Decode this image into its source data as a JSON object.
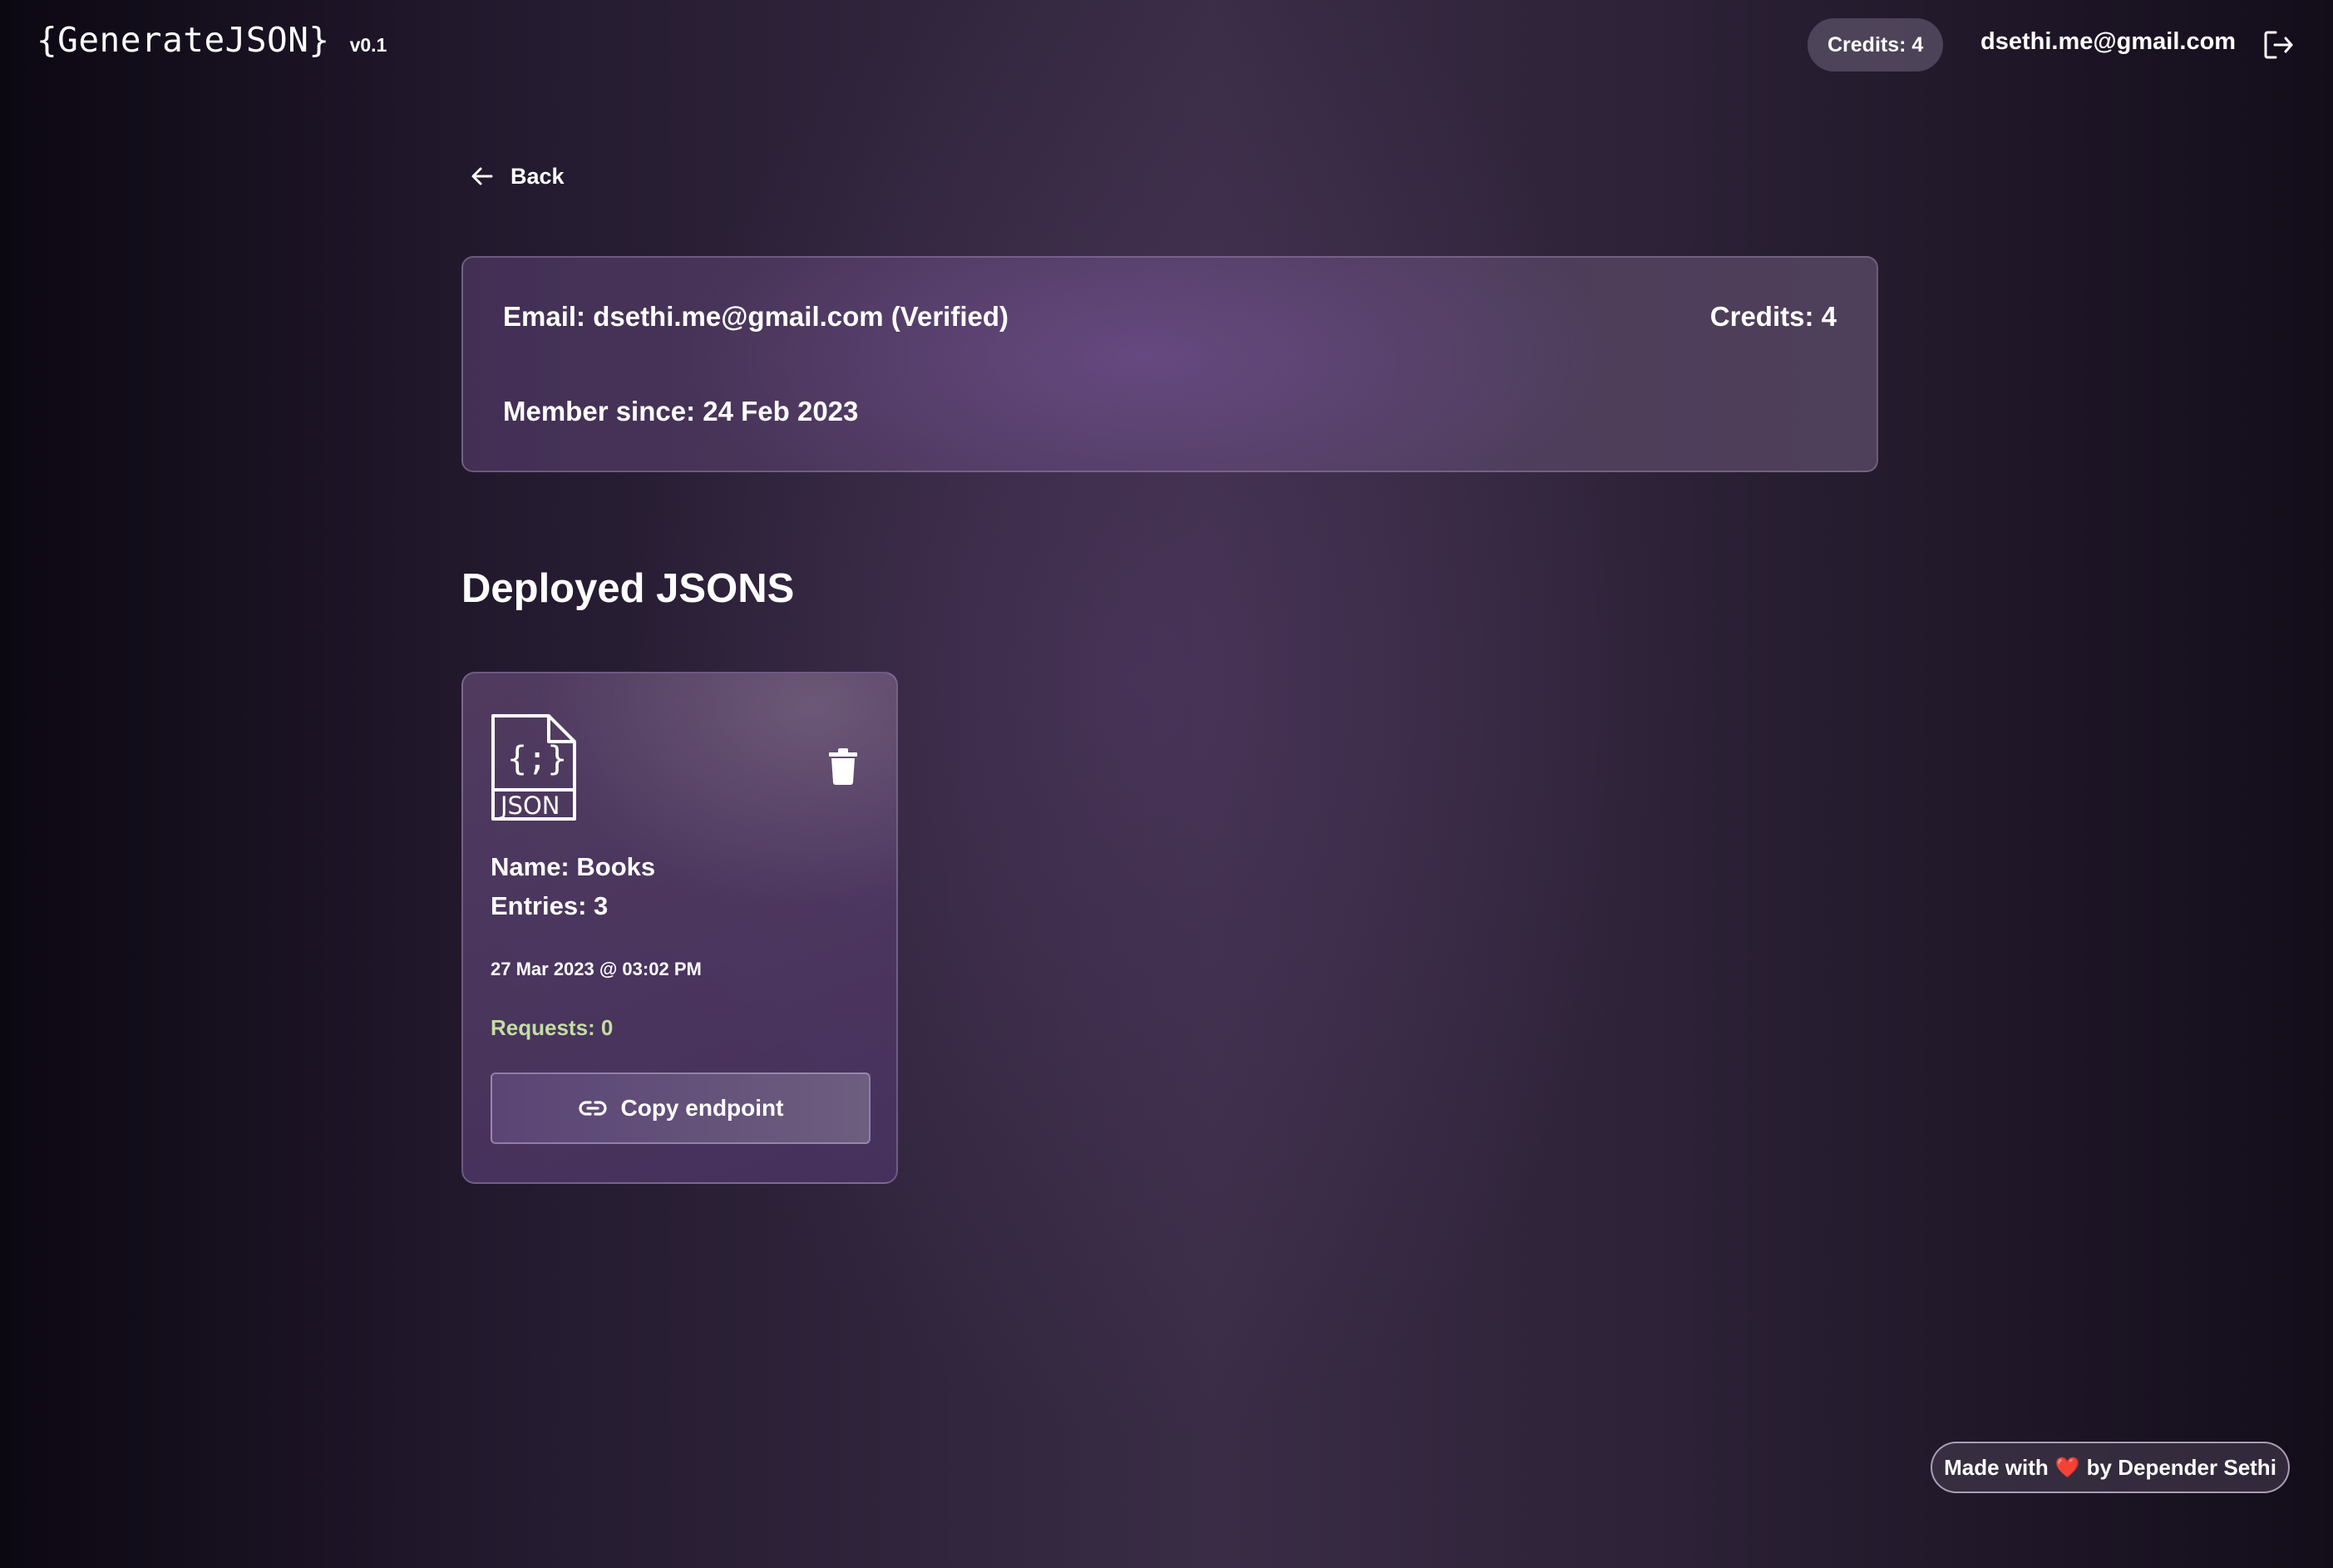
{
  "header": {
    "brand": "{GenerateJSON}",
    "version": "v0.1",
    "credits_label": "Credits: 4",
    "user_email": "dsethi.me@gmail.com",
    "logout_icon": "logout-icon"
  },
  "nav": {
    "back_label": "Back"
  },
  "profile": {
    "email": "Email: dsethi.me@gmail.com (Verified)",
    "credits": "Credits: 4",
    "member_since": "Member since: 24 Feb 2023"
  },
  "deployed": {
    "title": "Deployed JSONS",
    "items": [
      {
        "name": "Name: Books",
        "entries": "Entries: 3",
        "date": "27 Mar 2023 @ 03:02 PM",
        "requests": "Requests: 0",
        "copy_label": "Copy endpoint"
      }
    ]
  },
  "footer": {
    "made_with_prefix": "Made with",
    "made_with_heart": "❤️",
    "made_with_suffix": "by Depender Sethi"
  },
  "colors": {
    "requests_text": "#c4dea0",
    "heart": "#e0323a"
  }
}
